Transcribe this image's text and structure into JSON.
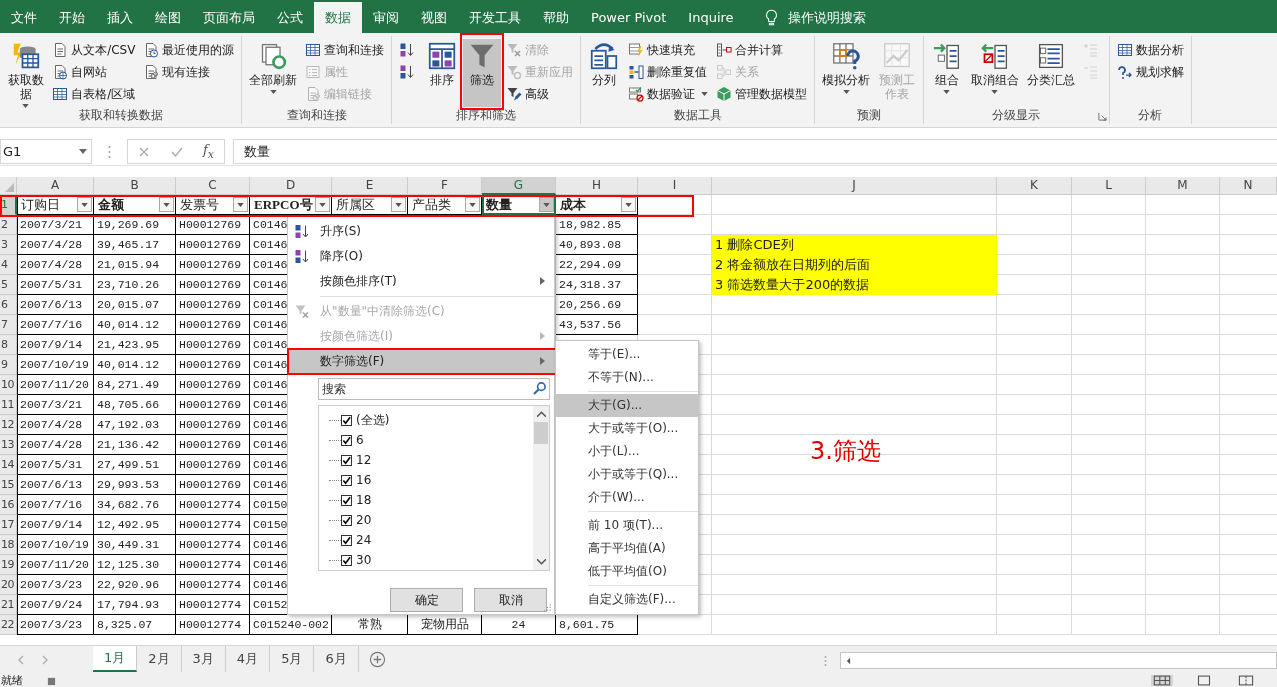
{
  "ribbon_tabs": [
    {
      "label": "文件",
      "selected": false
    },
    {
      "label": "开始",
      "selected": false
    },
    {
      "label": "插入",
      "selected": false
    },
    {
      "label": "绘图",
      "selected": false
    },
    {
      "label": "页面布局",
      "selected": false
    },
    {
      "label": "公式",
      "selected": false
    },
    {
      "label": "数据",
      "selected": true
    },
    {
      "label": "审阅",
      "selected": false
    },
    {
      "label": "视图",
      "selected": false
    },
    {
      "label": "开发工具",
      "selected": false
    },
    {
      "label": "帮助",
      "selected": false
    },
    {
      "label": "Power Pivot",
      "selected": false
    },
    {
      "label": "Inquire",
      "selected": false
    }
  ],
  "tell_me": "操作说明搜索",
  "ribbon": {
    "groups": [
      {
        "label": "获取和转换数据",
        "launcher": false,
        "items": [
          {
            "kind": "large",
            "label": "获取数据",
            "dropdown": true,
            "disabled": false
          },
          {
            "kind": "stack",
            "buttons": [
              {
                "label": "从文本/CSV",
                "disabled": false
              },
              {
                "label": "自网站",
                "disabled": false
              },
              {
                "label": "自表格/区域",
                "disabled": false
              }
            ]
          },
          {
            "kind": "stack",
            "buttons": [
              {
                "label": "最近使用的源",
                "disabled": false
              },
              {
                "label": "现有连接",
                "disabled": false
              }
            ]
          }
        ]
      },
      {
        "label": "查询和连接",
        "launcher": false,
        "items": [
          {
            "kind": "large",
            "label": "全部刷新",
            "dropdown": true,
            "disabled": false
          },
          {
            "kind": "stack",
            "buttons": [
              {
                "label": "查询和连接",
                "disabled": false
              },
              {
                "label": "属性",
                "disabled": true
              },
              {
                "label": "编辑链接",
                "disabled": true
              }
            ]
          }
        ]
      },
      {
        "label": "排序和筛选",
        "launcher": false,
        "items": [
          {
            "kind": "stack",
            "buttons": [
              {
                "disabled": false
              },
              {
                "disabled": false
              }
            ]
          },
          {
            "kind": "large",
            "label": "排序",
            "dropdown": false,
            "disabled": false
          },
          {
            "kind": "large",
            "label": "筛选",
            "dropdown": false,
            "disabled": false,
            "selected": true
          },
          {
            "kind": "stack",
            "buttons": [
              {
                "label": "清除",
                "disabled": true
              },
              {
                "label": "重新应用",
                "disabled": true
              },
              {
                "label": "高级",
                "disabled": false
              }
            ]
          }
        ]
      },
      {
        "label": "数据工具",
        "launcher": false,
        "items": [
          {
            "kind": "large",
            "label": "分列",
            "dropdown": false,
            "disabled": false
          },
          {
            "kind": "stack",
            "buttons": [
              {
                "label": "快速填充",
                "disabled": false
              },
              {
                "label": "删除重复值",
                "disabled": false
              },
              {
                "label": "数据验证",
                "disabled": false,
                "dropdown": true
              }
            ]
          },
          {
            "kind": "stack",
            "buttons": [
              {
                "label": "合并计算",
                "disabled": false
              },
              {
                "label": "关系",
                "disabled": true
              },
              {
                "label": "管理数据模型",
                "disabled": false
              }
            ]
          }
        ]
      },
      {
        "label": "预测",
        "launcher": false,
        "items": [
          {
            "kind": "large",
            "label": "模拟分析",
            "dropdown": true,
            "disabled": false
          },
          {
            "kind": "large",
            "label": "预测工作表",
            "dropdown": false,
            "disabled": true
          }
        ]
      },
      {
        "label": "分级显示",
        "launcher": true,
        "items": [
          {
            "kind": "large",
            "label": "组合",
            "dropdown": true,
            "disabled": false
          },
          {
            "kind": "large",
            "label": "取消组合",
            "dropdown": true,
            "disabled": false
          },
          {
            "kind": "large",
            "label": "分类汇总",
            "dropdown": false,
            "disabled": false
          },
          {
            "kind": "stack",
            "buttons": [
              {
                "disabled": true
              },
              {
                "disabled": true
              }
            ]
          }
        ]
      },
      {
        "label": "分析",
        "launcher": false,
        "items": [
          {
            "kind": "stack",
            "buttons": [
              {
                "label": "数据分析",
                "disabled": false
              },
              {
                "label": "规划求解",
                "disabled": false
              }
            ]
          }
        ]
      }
    ]
  },
  "formula_bar": {
    "name_box": "G1",
    "function_label": "f$_{x}$",
    "formula": "数量"
  },
  "sheet": {
    "columns": [
      {
        "label": "A",
        "selected": false
      },
      {
        "label": "B",
        "selected": false
      },
      {
        "label": "C",
        "selected": false
      },
      {
        "label": "D",
        "selected": false
      },
      {
        "label": "E",
        "selected": false
      },
      {
        "label": "F",
        "selected": false
      },
      {
        "label": "G",
        "selected": true
      },
      {
        "label": "H",
        "selected": false
      },
      {
        "label": "I",
        "selected": false
      },
      {
        "label": "J",
        "selected": false
      },
      {
        "label": "K",
        "selected": false
      },
      {
        "label": "L",
        "selected": false
      },
      {
        "label": "M",
        "selected": false
      },
      {
        "label": "N",
        "selected": false
      }
    ],
    "header_row": {
      "num": "1",
      "selected": true,
      "cells": [
        {
          "label": "订购日",
          "bold": false,
          "active": false
        },
        {
          "label": "金额",
          "bold": true,
          "active": false
        },
        {
          "label": "发票号",
          "bold": false,
          "active": false
        },
        {
          "label": "ERPCO号",
          "bold": true,
          "active": false
        },
        {
          "label": "所属区",
          "bold": false,
          "active": false
        },
        {
          "label": "产品类",
          "bold": false,
          "active": false
        },
        {
          "label": "数量",
          "bold": true,
          "active": true
        },
        {
          "label": "成本",
          "bold": true,
          "active": false
        }
      ]
    },
    "rows": [
      {
        "num": "2",
        "cells": [
          "2007/3/21",
          "19,269.69",
          "H00012769",
          "C0146",
          null,
          null,
          null,
          "18,982.85"
        ]
      },
      {
        "num": "3",
        "cells": [
          "2007/4/28",
          "39,465.17",
          "H00012769",
          "C0146",
          null,
          null,
          null,
          "40,893.08"
        ],
        "note": "1 删除CDE列"
      },
      {
        "num": "4",
        "cells": [
          "2007/4/28",
          "21,015.94",
          "H00012769",
          "C0146",
          null,
          null,
          null,
          "22,294.09"
        ],
        "note": "2 将金额放在日期列的后面"
      },
      {
        "num": "5",
        "cells": [
          "2007/5/31",
          "23,710.26",
          "H00012769",
          "C0146",
          null,
          null,
          null,
          "24,318.37"
        ],
        "note": "3 筛选数量大于200的数据"
      },
      {
        "num": "6",
        "cells": [
          "2007/6/13",
          "20,015.07",
          "H00012769",
          "C0146",
          null,
          null,
          null,
          "20,256.69"
        ]
      },
      {
        "num": "7",
        "cells": [
          "2007/7/16",
          "40,014.12",
          "H00012769",
          "C0146",
          null,
          null,
          null,
          "43,537.56"
        ]
      },
      {
        "num": "8",
        "cells": [
          "2007/9/14",
          "21,423.95",
          "H00012769",
          "C0146",
          null,
          null,
          null,
          null
        ]
      },
      {
        "num": "9",
        "cells": [
          "2007/10/19",
          "40,014.12",
          "H00012769",
          "C0146",
          null,
          null,
          null,
          null
        ]
      },
      {
        "num": "10",
        "cells": [
          "2007/11/20",
          "84,271.49",
          "H00012769",
          "C0146",
          null,
          null,
          null,
          null
        ]
      },
      {
        "num": "11",
        "cells": [
          "2007/3/21",
          "48,705.66",
          "H00012769",
          "C0146",
          null,
          null,
          null,
          null
        ]
      },
      {
        "num": "12",
        "cells": [
          "2007/4/28",
          "47,192.03",
          "H00012769",
          "C0146",
          null,
          null,
          null,
          null
        ]
      },
      {
        "num": "13",
        "cells": [
          "2007/4/28",
          "21,136.42",
          "H00012769",
          "C0146",
          null,
          null,
          null,
          null
        ]
      },
      {
        "num": "14",
        "cells": [
          "2007/5/31",
          "27,499.51",
          "H00012769",
          "C0146",
          null,
          null,
          null,
          null
        ]
      },
      {
        "num": "15",
        "cells": [
          "2007/6/13",
          "29,993.53",
          "H00012769",
          "C0146",
          null,
          null,
          null,
          null
        ]
      },
      {
        "num": "16",
        "cells": [
          "2007/7/16",
          "34,682.76",
          "H00012774",
          "C0150",
          null,
          null,
          null,
          null
        ]
      },
      {
        "num": "17",
        "cells": [
          "2007/9/14",
          "12,492.95",
          "H00012774",
          "C0150",
          null,
          null,
          null,
          null
        ]
      },
      {
        "num": "18",
        "cells": [
          "2007/10/19",
          "30,449.31",
          "H00012774",
          "C0146",
          null,
          null,
          null,
          null
        ]
      },
      {
        "num": "19",
        "cells": [
          "2007/11/20",
          "12,125.30",
          "H00012774",
          "C0146",
          null,
          null,
          null,
          null
        ]
      },
      {
        "num": "20",
        "cells": [
          "2007/3/23",
          "22,920.96",
          "H00012774",
          "C0146",
          null,
          null,
          null,
          null
        ]
      },
      {
        "num": "21",
        "cells": [
          "2007/9/24",
          "17,794.93",
          "H00012774",
          "C0152",
          null,
          null,
          null,
          null
        ]
      },
      {
        "num": "22",
        "cells": [
          "2007/3/23",
          "8,325.07",
          "H00012774",
          "C015240-002",
          "常熟",
          "宠物用品",
          "24",
          "8,601.75"
        ]
      }
    ]
  },
  "filter_menu": {
    "items": [
      {
        "kind": "command",
        "label": "升序(S)",
        "disabled": false,
        "highlighted": false,
        "submenu": false
      },
      {
        "kind": "command",
        "label": "降序(O)",
        "disabled": false,
        "highlighted": false,
        "submenu": false
      },
      {
        "kind": "command",
        "label": "按颜色排序(T)",
        "disabled": false,
        "highlighted": false,
        "submenu": true
      },
      {
        "kind": "separator"
      },
      {
        "kind": "command",
        "label": "从\"数量\"中清除筛选(C)",
        "disabled": true,
        "highlighted": false,
        "submenu": false
      },
      {
        "kind": "command",
        "label": "按颜色筛选(I)",
        "disabled": true,
        "highlighted": false,
        "submenu": true
      },
      {
        "kind": "command",
        "label": "数字筛选(F)",
        "disabled": false,
        "highlighted": true,
        "submenu": true
      }
    ],
    "search": {
      "placeholder": "搜索"
    },
    "values": [
      {
        "label": "(全选)",
        "checked": true
      },
      {
        "label": "6",
        "checked": true
      },
      {
        "label": "12",
        "checked": true
      },
      {
        "label": "16",
        "checked": true
      },
      {
        "label": "18",
        "checked": true
      },
      {
        "label": "20",
        "checked": true
      },
      {
        "label": "24",
        "checked": true
      },
      {
        "label": "30",
        "checked": true
      }
    ],
    "buttons": [
      "确定",
      "取消"
    ]
  },
  "number_filter_menu": {
    "items": [
      {
        "kind": "command",
        "label": "等于(E)...",
        "highlighted": false
      },
      {
        "kind": "command",
        "label": "不等于(N)...",
        "highlighted": false
      },
      {
        "kind": "separator"
      },
      {
        "kind": "command",
        "label": "大于(G)...",
        "highlighted": true
      },
      {
        "kind": "command",
        "label": "大于或等于(O)...",
        "highlighted": false
      },
      {
        "kind": "command",
        "label": "小于(L)...",
        "highlighted": false
      },
      {
        "kind": "command",
        "label": "小于或等于(Q)...",
        "highlighted": false
      },
      {
        "kind": "command",
        "label": "介于(W)...",
        "highlighted": false
      },
      {
        "kind": "separator"
      },
      {
        "kind": "command",
        "label": "前 10 项(T)...",
        "highlighted": false
      },
      {
        "kind": "command",
        "label": "高于平均值(A)",
        "highlighted": false
      },
      {
        "kind": "command",
        "label": "低于平均值(O)",
        "highlighted": false
      },
      {
        "kind": "separator"
      },
      {
        "kind": "command",
        "label": "自定义筛选(F)...",
        "highlighted": false
      }
    ]
  },
  "annotation_label": "3.筛选",
  "sheet_tabs": [
    {
      "label": "1月",
      "selected": true
    },
    {
      "label": "2月",
      "selected": false
    },
    {
      "label": "3月",
      "selected": false
    },
    {
      "label": "4月",
      "selected": false
    },
    {
      "label": "5月",
      "selected": false
    },
    {
      "label": "6月",
      "selected": false
    }
  ],
  "status_bar": {
    "text": "就绪"
  }
}
